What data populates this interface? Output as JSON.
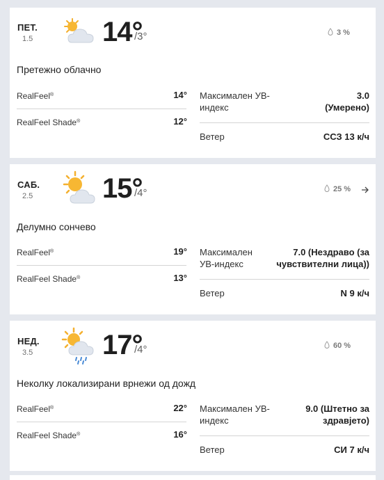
{
  "labels": {
    "realfeel": "RealFeel",
    "realfeel_shade": "RealFeel Shade",
    "trademark": "®",
    "uv": "Максимален УВ-индекс",
    "wind": "Ветер"
  },
  "days": [
    {
      "name": "ПЕТ.",
      "date": "1.5",
      "icon": "partly-cloudy-sun-icon",
      "high": "14°",
      "low": "/3°",
      "precip": "3 %",
      "phrase": "Претежно облачно",
      "realfeel": "14°",
      "realfeel_shade": "12°",
      "uv_value": "3.0",
      "uv_desc": "(Умерено)",
      "wind": "ССЗ 13 к/ч"
    },
    {
      "name": "САБ.",
      "date": "2.5",
      "icon": "sun-behind-cloud-icon",
      "high": "15°",
      "low": "/4°",
      "precip": "25 %",
      "phrase": "Делумно сончево",
      "realfeel": "19°",
      "realfeel_shade": "13°",
      "uv_value": "7.0",
      "uv_desc": "(Нездраво (за чувствителни лица))",
      "uv_line1": "7.0 (Нездраво (за",
      "uv_line2": "чувствителни лица))",
      "wind": "N 9 к/ч"
    },
    {
      "name": "НЕД.",
      "date": "3.5",
      "icon": "sun-cloud-rain-icon",
      "high": "17°",
      "low": "/4°",
      "precip": "60 %",
      "phrase": "Неколку локализирани врнежи од дожд",
      "realfeel": "22°",
      "realfeel_shade": "16°",
      "uv_value": "9.0",
      "uv_desc": "(Штетно за здравјето)",
      "uv_line1": "9.0 (Штетно за",
      "uv_line2": "здравјето)",
      "wind": "СИ 7 к/ч"
    }
  ]
}
